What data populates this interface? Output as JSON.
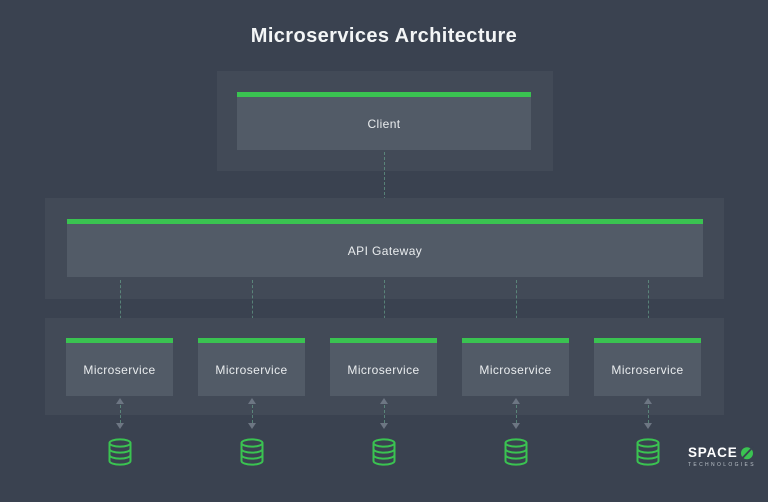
{
  "title": "Microservices Architecture",
  "colors": {
    "background": "#3a4250",
    "group_container": "#424a57",
    "node_box": "#525b67",
    "accent_green": "#3ac351",
    "node_text": "#e9ecee",
    "title_text": "#f3f5f6",
    "connector_dash": "#6fb698",
    "arrow_head": "#6d7683"
  },
  "diagram": {
    "client": {
      "label": "Client"
    },
    "api_gateway": {
      "label": "API Gateway"
    },
    "microservices": [
      {
        "label": "Microservice"
      },
      {
        "label": "Microservice"
      },
      {
        "label": "Microservice"
      },
      {
        "label": "Microservice"
      },
      {
        "label": "Microservice"
      }
    ],
    "database_count": 5
  },
  "icons": {
    "database": "database-cylinder",
    "arrow_down": "triangle-down",
    "arrow_up": "triangle-up",
    "logo_mark": "green-circle-slash"
  },
  "logo": {
    "brand": "SPACE",
    "subtext": "TECHNOLOGIES"
  }
}
